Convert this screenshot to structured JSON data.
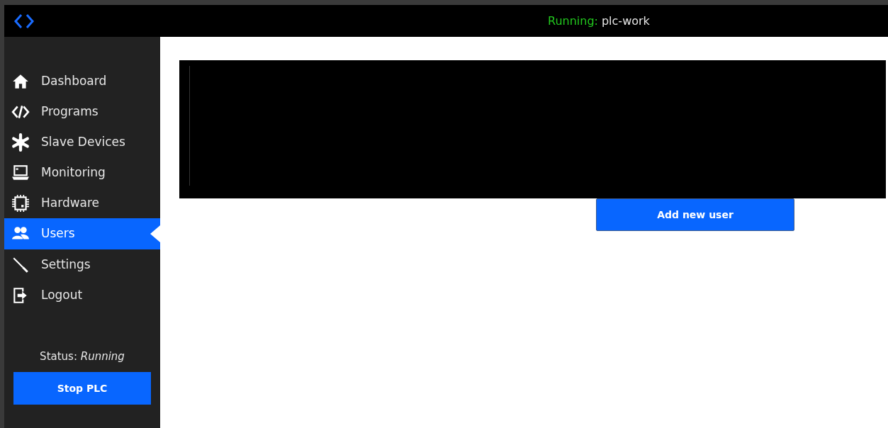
{
  "header": {
    "running_label": "Running:",
    "program_name": "plc-work"
  },
  "sidebar": {
    "items": [
      {
        "label": "Dashboard",
        "kind": "home",
        "selected": false
      },
      {
        "label": "Programs",
        "kind": "code",
        "selected": false
      },
      {
        "label": "Slave Devices",
        "kind": "snowflake",
        "selected": false
      },
      {
        "label": "Monitoring",
        "kind": "laptop",
        "selected": false
      },
      {
        "label": "Hardware",
        "kind": "chip",
        "selected": false
      },
      {
        "label": "Users",
        "kind": "users",
        "selected": true
      },
      {
        "label": "Settings",
        "kind": "screwdriver",
        "selected": false
      },
      {
        "label": "Logout",
        "kind": "logout",
        "selected": false
      }
    ],
    "status_label": "Status:",
    "status_value": "Running",
    "stop_button": "Stop PLC"
  },
  "main": {
    "add_button": "Add new user"
  }
}
